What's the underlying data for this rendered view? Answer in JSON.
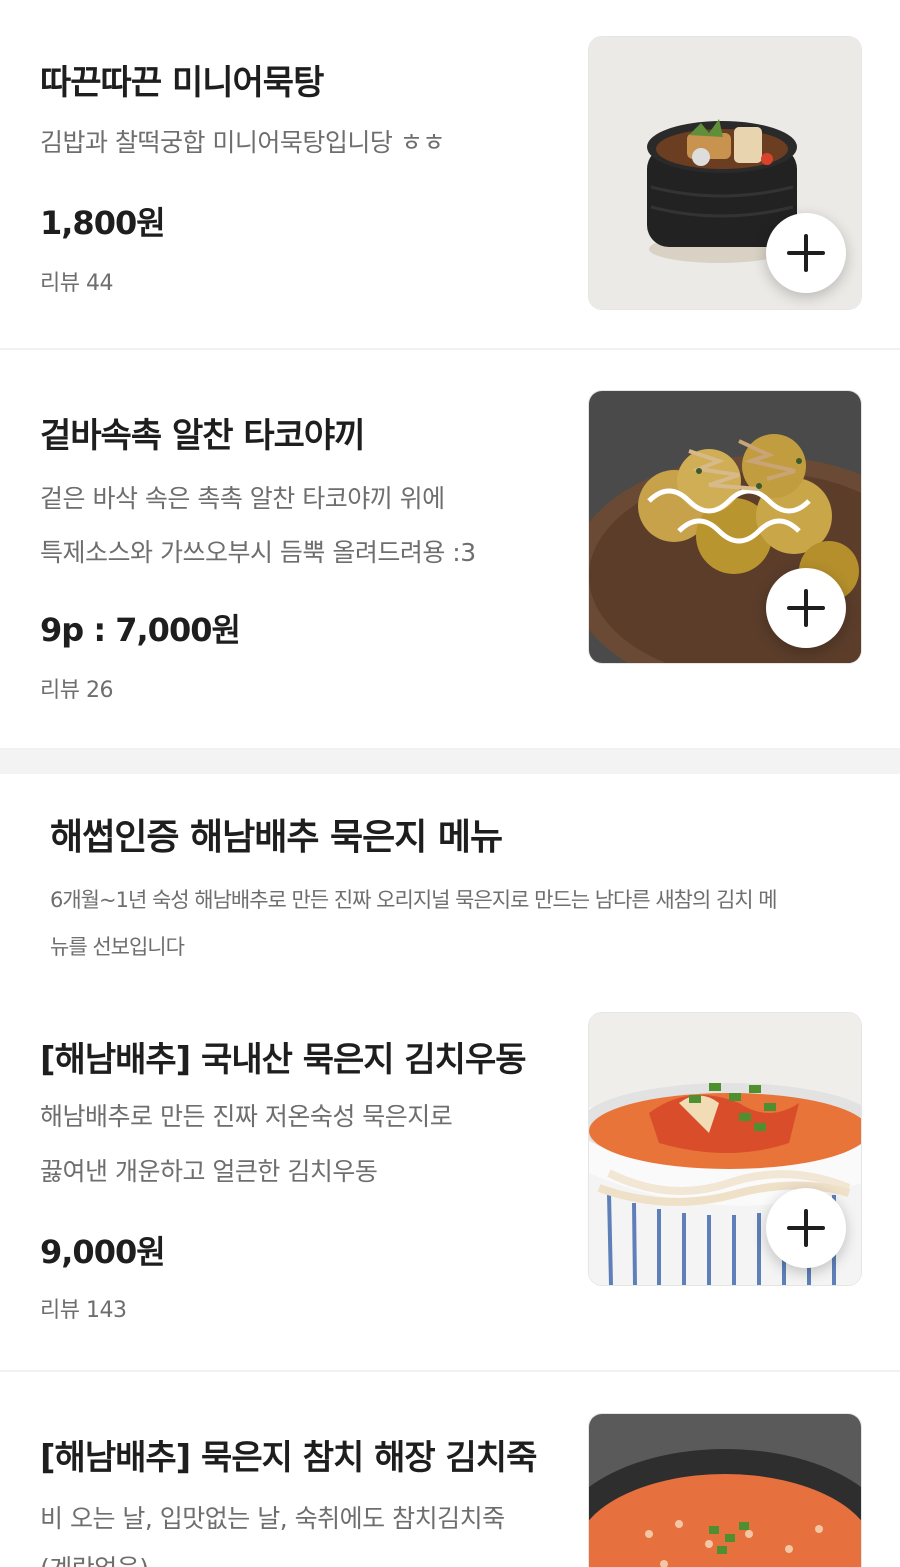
{
  "items": [
    {
      "name": "따끈따끈 미니어묵탕",
      "desc": [
        "김밥과 찰떡궁합 미니어묵탕입니당 ㅎㅎ"
      ],
      "price": "1,800원",
      "review": "리뷰 44",
      "add_icon": "plus-icon"
    },
    {
      "name": "겉바속촉 알찬 타코야끼",
      "desc": [
        "겉은 바삭 속은 촉촉 알찬 타코야끼 위에",
        "특제소스와 가쓰오부시 듬뿍 올려드려용 :3"
      ],
      "price": "9p : 7,000원",
      "review": "리뷰 26",
      "add_icon": "plus-icon"
    },
    {
      "name": "[해남배추] 국내산 묵은지 김치우동",
      "desc": [
        "해남배추로 만든 진짜 저온숙성 묵은지로",
        "끓여낸 개운하고 얼큰한 김치우동"
      ],
      "price": "9,000원",
      "review": "리뷰 143",
      "add_icon": "plus-icon"
    },
    {
      "name": "[해남배추] 묵은지 참치 해장 김치죽",
      "desc": [
        "비 오는 날, 입맛없는 날, 숙취에도 참치김치죽",
        "(계란없음)"
      ],
      "price": "",
      "review": "",
      "add_icon": "plus-icon"
    }
  ],
  "section": {
    "title": "해썹인증 해남배추 묵은지 메뉴",
    "desc": [
      "6개월~1년 숙성 해남배추로 만든 진짜 오리지널 묵은지로 만드는 남다른 새참의 김치 메",
      "뉴를 선보입니다"
    ]
  },
  "colors": {
    "text_primary": "#1e1e1e",
    "text_secondary": "#6e6e6e",
    "divider": "#f1f1f1",
    "section_gap": "#f3f3f3"
  }
}
